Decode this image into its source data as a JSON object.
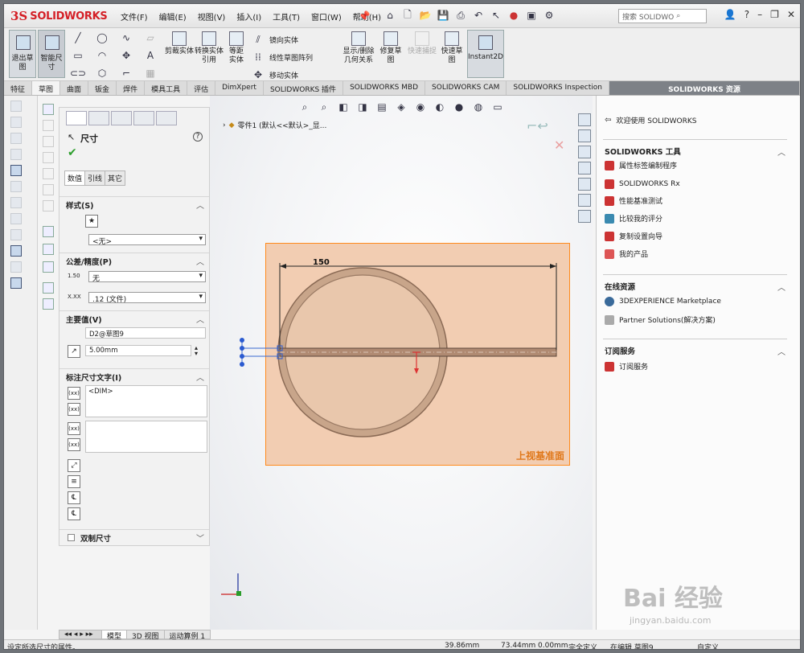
{
  "app": {
    "brand": "SOLIDWORKS",
    "accent": "#d41f26"
  },
  "menu": [
    "文件(F)",
    "编辑(E)",
    "视图(V)",
    "插入(I)",
    "工具(T)",
    "窗口(W)",
    "帮助(H)"
  ],
  "search": {
    "placeholder": "搜索 SOLIDWO"
  },
  "command": {
    "exit_sketch": "退出草图",
    "smart_dim": "智能尺寸",
    "trim": "剪裁实体",
    "convert": "转换实体引用",
    "offset": "等距实体",
    "mirror": "镜向实体",
    "linear_pattern": "线性草图阵列",
    "move": "移动实体",
    "display_relations": "显示/删除几何关系",
    "repair": "修复草图",
    "rapid_snaps": "快速捕捉",
    "rapid_sketch": "快速草图",
    "instant2d": "Instant2D"
  },
  "tabs": [
    "特征",
    "草图",
    "曲面",
    "钣金",
    "焊件",
    "模具工具",
    "评估",
    "DimXpert",
    "SOLIDWORKS 插件",
    "SOLIDWORKS MBD",
    "SOLIDWORKS CAM",
    "SOLIDWORKS Inspection"
  ],
  "resources_tab": "SOLIDWORKS 资源",
  "pm": {
    "title": "尺寸",
    "subtabs": [
      "数值",
      "引线",
      "其它"
    ],
    "style": {
      "header": "样式(S)",
      "select": "<无>"
    },
    "tolerance": {
      "header": "公差/精度(P)",
      "type": "无",
      "precision": ".12 (文件)",
      "icon_text": "1.50",
      "icon_text2": "X.XX"
    },
    "primary": {
      "header": "主要值(V)",
      "name": "D2@草图9",
      "value": "5.00mm"
    },
    "dimtext": {
      "header": "标注尺寸文字(I)",
      "content": "<DIM>"
    },
    "dual": "双制尺寸"
  },
  "graphics": {
    "tree": "零件1 (默认<<默认>_显...",
    "dim_value": "150",
    "plane_label": "上视基准面"
  },
  "taskpane": {
    "welcome": "欢迎使用 SOLIDWORKS",
    "tools_header": "SOLIDWORKS 工具",
    "tools": [
      "属性标签编制程序",
      "SOLIDWORKS Rx",
      "性能基准测试",
      "比较我的评分",
      "复制设置向导",
      "我的产品"
    ],
    "online_header": "在线资源",
    "online": [
      "3DEXPERIENCE Marketplace",
      "Partner Solutions(解决方案)"
    ],
    "sub_header": "订阅服务",
    "sub": [
      "订阅服务"
    ]
  },
  "bottom_tabs": [
    "模型",
    "3D 视图",
    "运动算例 1"
  ],
  "status": {
    "message": "设定所选尺寸的属性。",
    "x": "39.86mm",
    "y": "73.44mm",
    "z": "0.00mm",
    "state": "完全定义",
    "editing": "在编辑 草图9",
    "custom": "自定义"
  },
  "watermark": {
    "text": "Bai 经验",
    "url": "jingyan.baidu.com"
  }
}
